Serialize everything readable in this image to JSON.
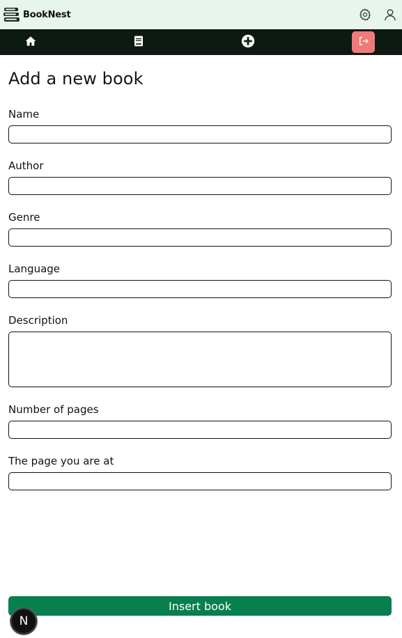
{
  "app": {
    "name": "BookNest"
  },
  "header": {
    "icons": [
      "settings-gear-icon",
      "user-profile-icon"
    ]
  },
  "nav": {
    "items": [
      {
        "icon": "home-icon"
      },
      {
        "icon": "book-icon"
      },
      {
        "icon": "add-circle-icon"
      },
      {
        "icon": "logout-icon"
      }
    ],
    "logout_color": "#f07a7a",
    "bar_color": "#0d1a12"
  },
  "form": {
    "title": "Add a new book",
    "fields": {
      "name": {
        "label": "Name",
        "value": ""
      },
      "author": {
        "label": "Author",
        "value": ""
      },
      "genre": {
        "label": "Genre",
        "value": ""
      },
      "language": {
        "label": "Language",
        "value": ""
      },
      "description": {
        "label": "Description",
        "value": ""
      },
      "pages": {
        "label": "Number of pages",
        "value": ""
      },
      "current_page": {
        "label": "The page you are at",
        "value": ""
      }
    },
    "submit_label": "Insert book",
    "submit_color": "#087f4e"
  },
  "dev_badge": {
    "label": "N"
  },
  "colors": {
    "header_bg": "#e8f5ec",
    "accent_green": "#087f4e"
  }
}
